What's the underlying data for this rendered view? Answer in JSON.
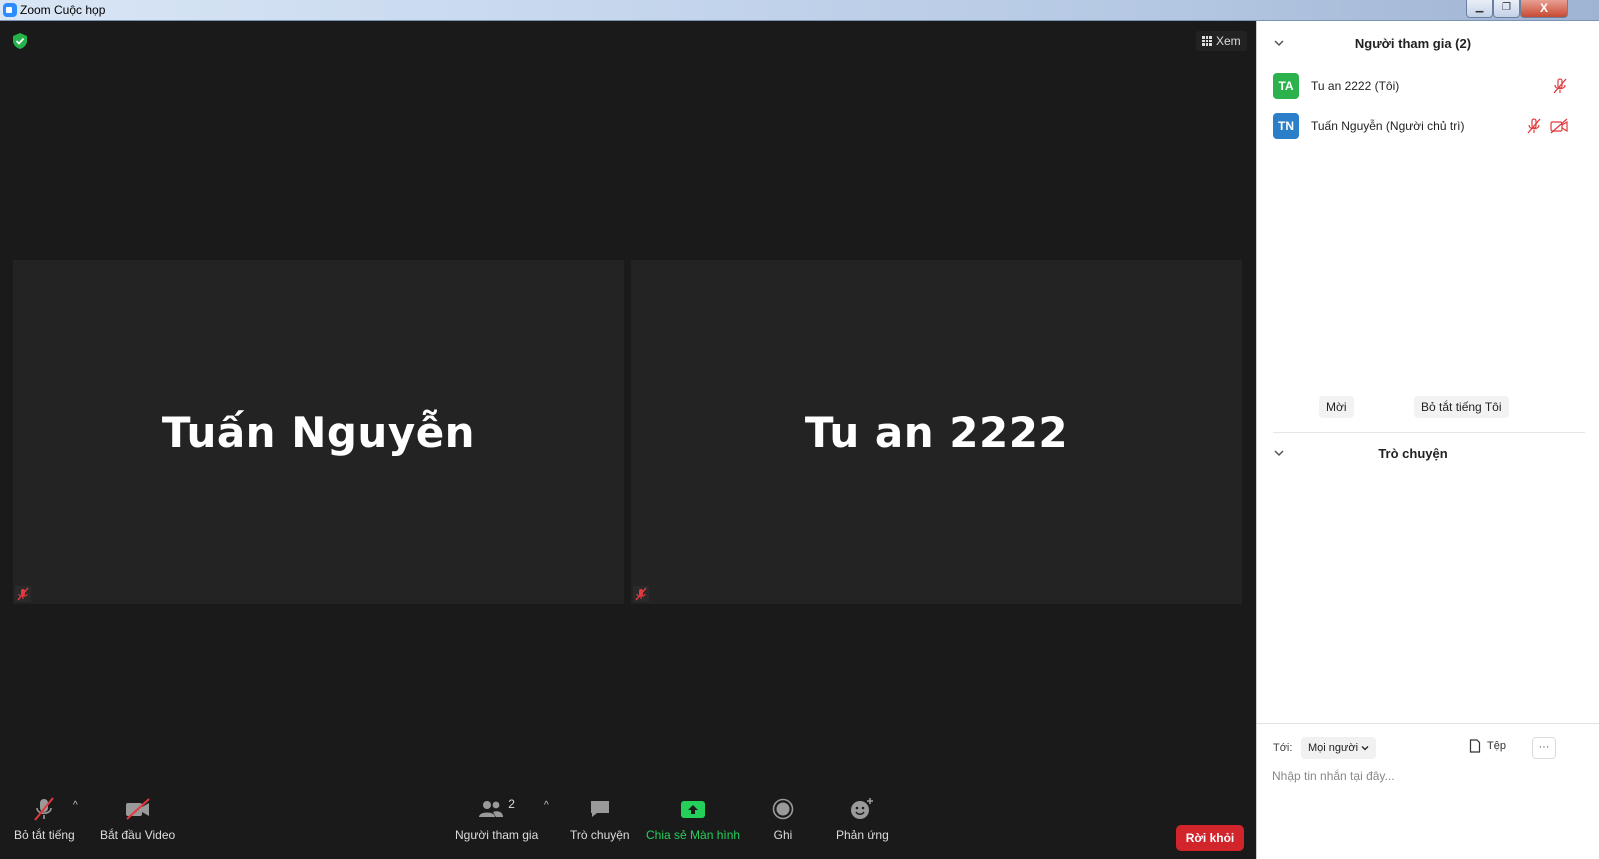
{
  "window": {
    "title": "Zoom Cuộc họp",
    "controls": {
      "minimize": "▁",
      "restore": "❐",
      "close": "X"
    }
  },
  "meeting": {
    "view_label": "Xem",
    "tiles": [
      {
        "name": "Tuấn Nguyễn"
      },
      {
        "name": "Tu an 2222"
      }
    ]
  },
  "toolbar": {
    "mute_label": "Bỏ tắt tiếng",
    "video_label": "Bắt đầu Video",
    "participants_label": "Người tham gia",
    "participants_count": "2",
    "chat_label": "Trò chuyện",
    "share_label": "Chia sẻ Màn hình",
    "record_label": "Ghi",
    "reactions_label": "Phản ứng",
    "leave_label": "Rời khỏi",
    "caret": "^"
  },
  "panel": {
    "participants_title": "Người tham gia (2)",
    "participants": [
      {
        "initials": "TA",
        "name": "Tu an 2222 (Tôi)",
        "color": "#2bb24c"
      },
      {
        "initials": "TN",
        "name": "Tuấn Nguyễn (Người chủ trì)",
        "color": "#2b7fc8"
      }
    ],
    "invite_label": "Mời",
    "unmute_me_label": "Bỏ tắt tiếng Tôi",
    "chat_title": "Trò chuyện",
    "to_label": "Tới:",
    "to_value": "Mọi người",
    "file_label": "Tệp",
    "more_label": "···",
    "message_placeholder": "Nhập tin nhắn tại đây..."
  },
  "colors": {
    "accent_green": "#25d05a",
    "leave_red": "#d1242b",
    "muted_red": "#e0393e"
  }
}
